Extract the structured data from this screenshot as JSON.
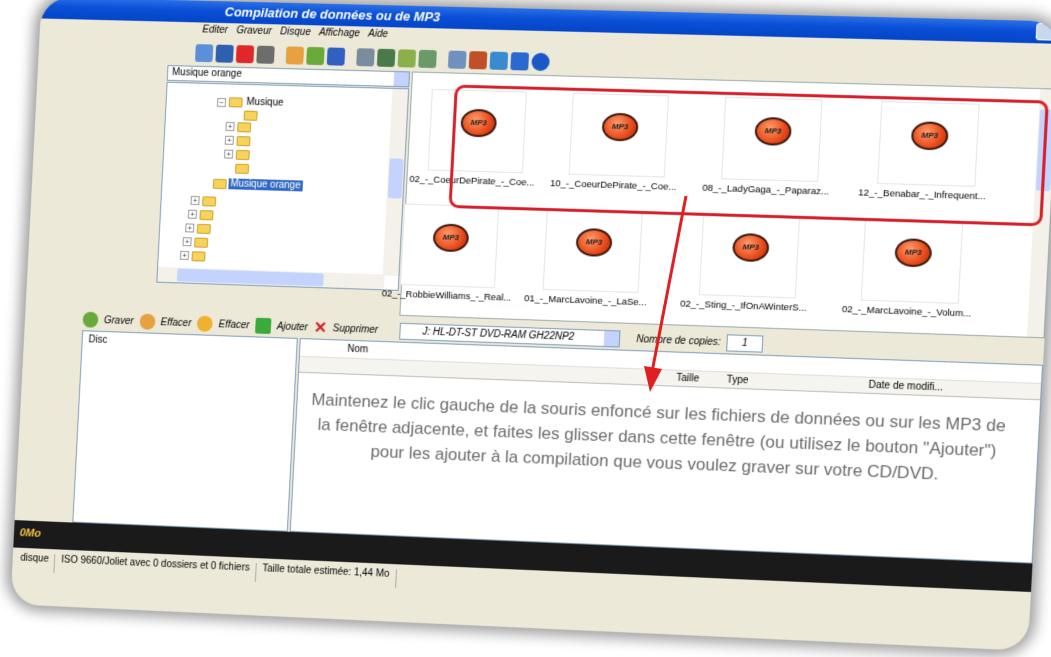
{
  "window": {
    "title": "Compilation de données ou de MP3"
  },
  "menu": [
    "Editer",
    "Graveur",
    "Disque",
    "Affichage",
    "Aide"
  ],
  "toolbar_icons": [
    "new-icon",
    "save-icon",
    "delete-icon",
    "print-icon",
    "add-files-icon",
    "remove-files-icon",
    "blank-icon",
    "burn-icon",
    "erase-icon",
    "disc-icon",
    "cd-icon",
    "settings-icon",
    "audio-icon",
    "web-icon",
    "help-icon",
    "info-icon"
  ],
  "folder_path": "Musique orange",
  "tree": {
    "musique": "Musique",
    "selected": "Musique orange"
  },
  "files": [
    "02_-_CoeurDePirate_-_Coe...",
    "10_-_CoeurDePirate_-_Coe...",
    "08_-_LadyGaga_-_Paparaz...",
    "12_-_Benabar_-_Infrequent...",
    "02_-_RobbieWilliams_-_Real...",
    "01_-_MarcLavoine_-_LaSe...",
    "02_-_Sting_-_IfOnAWinterS...",
    "02_-_MarcLavoine_-_Volum..."
  ],
  "file_icon_label": "MP3",
  "actions": {
    "graver": "Graver",
    "effacer1": "Effacer",
    "effacer2": "Effacer",
    "ajouter": "Ajouter",
    "supprimer": "Supprimer"
  },
  "drive": "J: HL-DT-ST DVD-RAM GH22NP2",
  "copies": {
    "label": "Nombre de copies:",
    "value": "1"
  },
  "disc_label": "Disc",
  "columns": {
    "nom": "Nom",
    "taille": "Taille",
    "type": "Type",
    "date": "Date de modifi..."
  },
  "hint": "Maintenez le clic gauche de la souris enfoncé sur les fichiers de données ou sur les MP3 de la fenêtre adjacente, et faites les glisser dans cette fenêtre (ou utilisez le bouton \"Ajouter\") pour les ajouter à la compilation que vous voulez graver sur votre CD/DVD.",
  "status": {
    "capacity": "0Mo",
    "disc": "disque",
    "format": "ISO 9660/Joliet avec 0 dossiers et 0 fichiers",
    "size": "Taille totale estimée: 1,44 Mo"
  },
  "colors": {
    "highlight": "#d61f2a",
    "titlebar": "#0a4fd6",
    "mp3": "#e84a1a"
  }
}
